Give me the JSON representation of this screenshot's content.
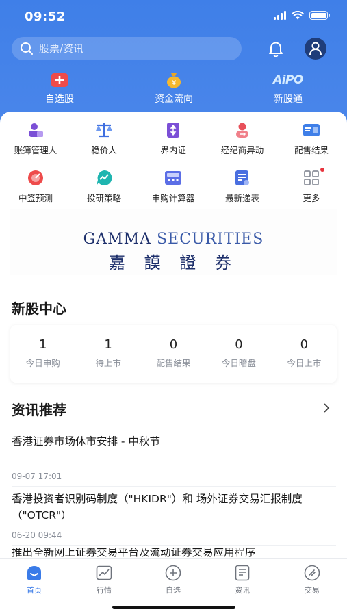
{
  "status_bar": {
    "time": "09:52"
  },
  "header": {
    "search_placeholder": "股票/资讯",
    "quick_links": [
      "自选股",
      "资金流向",
      "新股通"
    ],
    "ipo_logo_text": "AiPO"
  },
  "grid": {
    "row1": [
      "账簿管理人",
      "稳价人",
      "界内证",
      "经纪商异动",
      "配售结果"
    ],
    "row2": [
      "中签预测",
      "投研策略",
      "申购计算器",
      "最新递表",
      "更多"
    ]
  },
  "banner": {
    "line1_a": "GAMMA",
    "line1_b": "SECURITIES",
    "line2": "嘉 謨 證 券"
  },
  "ipo_center": {
    "title": "新股中心",
    "stats": [
      {
        "value": "1",
        "label": "今日申购"
      },
      {
        "value": "1",
        "label": "待上市"
      },
      {
        "value": "0",
        "label": "配售结果"
      },
      {
        "value": "0",
        "label": "今日暗盘"
      },
      {
        "value": "0",
        "label": "今日上市"
      }
    ]
  },
  "news": {
    "title": "资讯推荐",
    "items": [
      {
        "title": "香港证券市场休市安排 - 中秋节",
        "date": "09-07 17:01"
      },
      {
        "title": "香港投资者识别码制度（\"HKIDR\"）和 场外证券交易汇报制度（\"OTCR\"）",
        "date": "06-20 09:44"
      },
      {
        "title": "推出全新网上证券交易平台及流动证券交易应用程序",
        "date": ""
      }
    ]
  },
  "tabbar": {
    "tabs": [
      "首页",
      "行情",
      "自选",
      "资讯",
      "交易"
    ],
    "active": "首页"
  },
  "colors": {
    "brand": "#3f7fe8",
    "active_tab": "#3a7be8"
  }
}
